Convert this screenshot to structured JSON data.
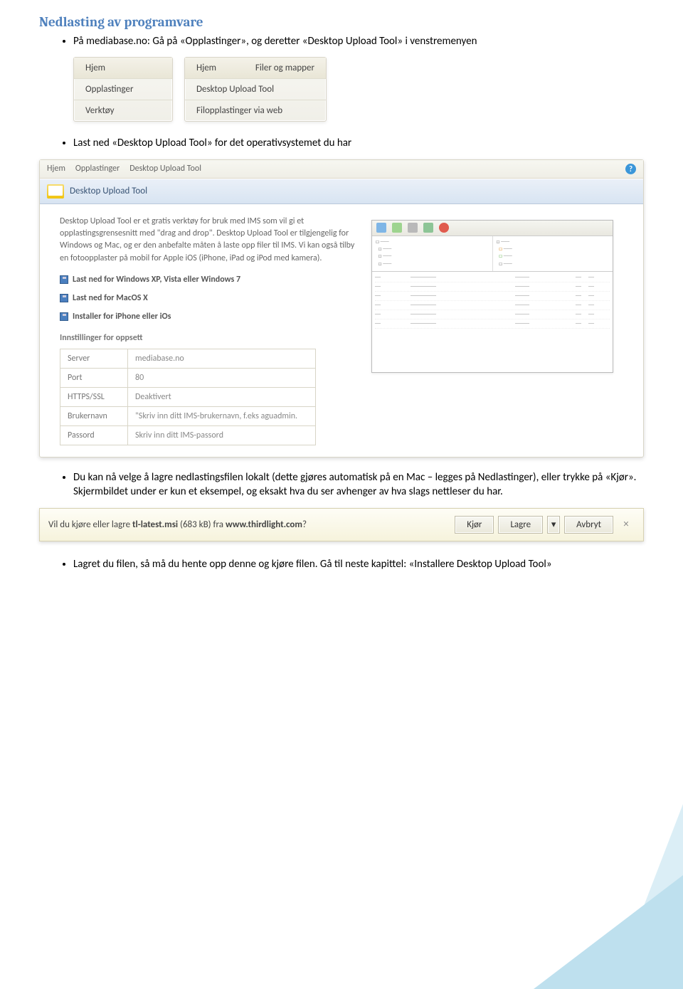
{
  "heading": "Nedlasting av programvare",
  "bullets": {
    "b1": "På mediabase.no: Gå på «Opplastinger», og deretter «Desktop Upload Tool» i venstremenyen",
    "b2": "Last ned «Desktop Upload Tool» for det operativsystemet du har",
    "b3": "Du kan nå velge å lagre nedlastingsfilen lokalt (dette gjøres automatisk på en Mac – legges på Nedlastinger), eller trykke på «Kjør». Skjermbildet under er kun et eksempel, og eksakt hva du ser avhenger av hva slags nettleser du har.",
    "b4": "Lagret du filen, så må du hente opp denne og kjøre filen. Gå til neste kapittel: «Installere Desktop Upload Tool»"
  },
  "menu1": {
    "i1": "Hjem",
    "i2": "Opplastinger",
    "i3": "Verktøy"
  },
  "menu2": {
    "h1": "Hjem",
    "h2": "Filer og mapper",
    "i1": "Desktop Upload Tool",
    "i2": "Filopplastinger via web"
  },
  "breadcrumb": {
    "a": "Hjem",
    "b": "Opplastinger",
    "c": "Desktop Upload Tool"
  },
  "panelTitle": "Desktop Upload Tool",
  "desc": "Desktop Upload Tool er et gratis verktøy for bruk med IMS som vil gi et opplastingsgrensesnitt med \"drag and drop\". Desktop Upload Tool er tilgjengelig for Windows og Mac, og er den anbefalte måten å laste opp filer til IMS. Vi kan også tilby en fotoopplaster på mobil for Apple iOS (iPhone, iPad og iPod med kamera).",
  "downloads": {
    "win": "Last ned for Windows XP, Vista eller Windows 7",
    "mac": "Last ned for MacOS X",
    "ios": "Installer for iPhone eller iOs"
  },
  "settingsTitle": "Innstillinger for oppsett",
  "settings": {
    "server_l": "Server",
    "server_v": "mediabase.no",
    "port_l": "Port",
    "port_v": "80",
    "ssl_l": "HTTPS/SSL",
    "ssl_v": "Deaktivert",
    "user_l": "Brukernavn",
    "user_v": "\"Skriv inn ditt IMS-brukernavn, f.eks aguadmin.",
    "pass_l": "Passord",
    "pass_v": "Skriv inn ditt IMS-passord"
  },
  "iebar": {
    "msg_a": "Vil du kjøre eller lagre ",
    "msg_b": "tl-latest.msi",
    "msg_c": " (683 kB) fra ",
    "msg_d": "www.thirdlight.com",
    "msg_e": "?",
    "run": "Kjør",
    "save": "Lagre",
    "cancel": "Avbryt"
  }
}
